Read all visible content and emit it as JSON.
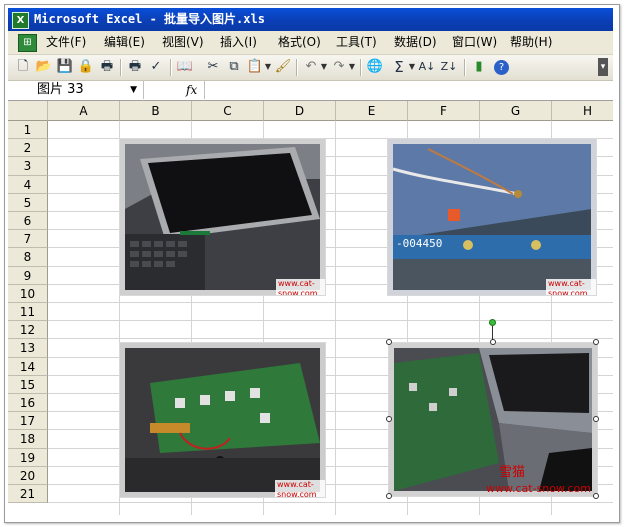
{
  "window": {
    "title": "Microsoft Excel - 批量导入图片.xls",
    "app_icon": "excel-icon"
  },
  "menu": {
    "items": [
      {
        "label": "文件(F)",
        "name": "file"
      },
      {
        "label": "编辑(E)",
        "name": "edit"
      },
      {
        "label": "视图(V)",
        "name": "view"
      },
      {
        "label": "插入(I)",
        "name": "insert"
      },
      {
        "label": "格式(O)",
        "name": "format"
      },
      {
        "label": "工具(T)",
        "name": "tools"
      },
      {
        "label": "数据(D)",
        "name": "data"
      },
      {
        "label": "窗口(W)",
        "name": "window"
      },
      {
        "label": "帮助(H)",
        "name": "help"
      }
    ]
  },
  "toolbar": {
    "icons": [
      "new-icon",
      "open-icon",
      "save-icon",
      "permission-icon",
      "print-icon",
      "print-preview-icon",
      "spelling-icon",
      "research-icon",
      "cut-icon",
      "copy-icon",
      "paste-icon",
      "format-painter-icon",
      "undo-icon",
      "redo-icon",
      "hyperlink-icon",
      "autosum-icon",
      "sort-ascending-icon",
      "sort-descending-icon",
      "chart-wizard-icon",
      "help-icon"
    ],
    "autosum_glyph": "Σ"
  },
  "formula_bar": {
    "name_box": "图片 33",
    "fx_label": "fx",
    "formula": ""
  },
  "sheet": {
    "columns": [
      "A",
      "B",
      "C",
      "D",
      "E",
      "F",
      "G",
      "H"
    ],
    "rows": [
      "1",
      "2",
      "3",
      "4",
      "5",
      "6",
      "7",
      "8",
      "9",
      "10",
      "11",
      "12",
      "13",
      "14",
      "15",
      "16",
      "17",
      "18",
      "19",
      "20",
      "21"
    ]
  },
  "pictures": [
    {
      "name": "picture-laptop-screen",
      "watermark": "www.cat-snow.com"
    },
    {
      "name": "picture-wifi-card",
      "watermark": "www.cat-snow.com",
      "label": "-004450"
    },
    {
      "name": "picture-motherboard",
      "watermark": "www.cat-snow.com"
    },
    {
      "name": "picture-laptop-open",
      "watermark": "www.cat-snow.com",
      "brand": "雪猫",
      "selected": true
    }
  ],
  "colors": {
    "title_bar": "#0b44c4",
    "ui_face": "#ece9d8",
    "gridline": "#d4d4d4",
    "watermark": "#cc0000"
  }
}
